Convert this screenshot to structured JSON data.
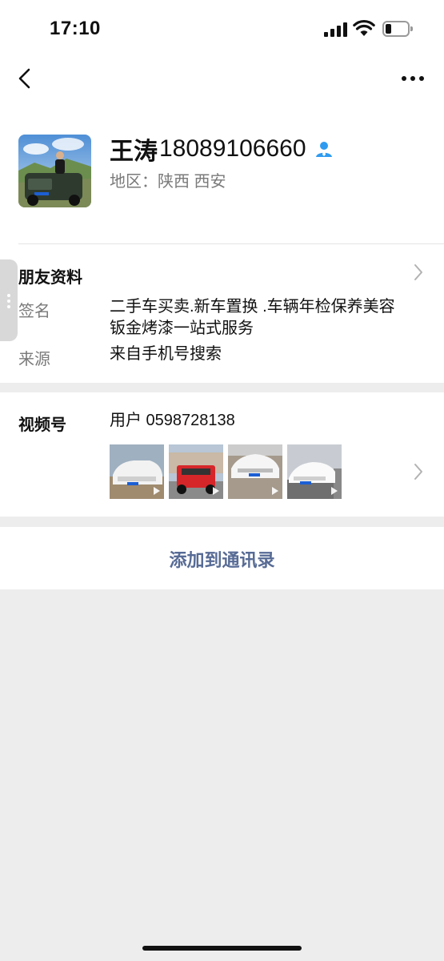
{
  "status_bar": {
    "time": "17:10",
    "battery_level": 0.25
  },
  "nav": {
    "back_icon": "chevron-left-icon",
    "more_icon": "more-dots-icon"
  },
  "profile": {
    "name": "王涛",
    "phone": "18089106660",
    "region": "地区：陕西 西安",
    "badge_icon": "contact-person-icon",
    "badge_color": "#2f9bf0"
  },
  "friend_info": {
    "title": "朋友资料"
  },
  "signature": {
    "label": "签名",
    "lines": [
      "二手车买卖.新车置换 .车辆年检保养美容",
      "钣金烤漆一站式服务"
    ]
  },
  "source": {
    "label": "来源",
    "value": "来自手机号搜索"
  },
  "channels": {
    "label": "视频号",
    "value": "用户 0598728138",
    "thumbnails": [
      "white-sedan-thumb",
      "red-jeep-thumb",
      "white-volkswagen-thumb",
      "white-mercedes-thumb"
    ]
  },
  "add_contact": {
    "label": "添加到通讯录",
    "color": "#576b95"
  }
}
